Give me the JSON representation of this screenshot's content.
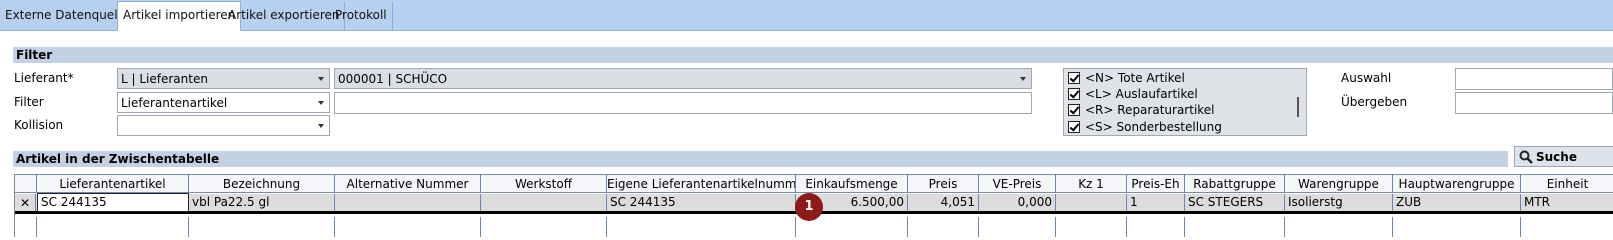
{
  "tabs": [
    {
      "label": "Externe Datenquelle"
    },
    {
      "label": "Artikel importieren"
    },
    {
      "label": "Artikel exportieren"
    },
    {
      "label": "Protokoll"
    }
  ],
  "filter": {
    "header": "Filter",
    "lieferant_label": "Lieferant*",
    "lieferant_type": "L | Lieferanten",
    "lieferant_value": "000001 | SCHÜCO",
    "filter_label": "Filter",
    "filter_value": "Lieferantenartikel",
    "filter_text": "",
    "kollision_label": "Kollision",
    "kollision_value": "",
    "checklist": [
      {
        "label": "<N> Tote Artikel",
        "checked": true
      },
      {
        "label": "<L> Auslaufartikel",
        "checked": true
      },
      {
        "label": "<R> Reparaturartikel",
        "checked": true
      },
      {
        "label": "<S> Sonderbestellung",
        "checked": true
      }
    ],
    "auswahl_label": "Auswahl",
    "uebergeben_label": "Übergeben"
  },
  "table": {
    "header": "Artikel in der Zwischentabelle",
    "search_label": "Suche",
    "columns": [
      "Lieferantenartikel",
      "Bezeichnung",
      "Alternative Nummer",
      "Werkstoff",
      "Eigene Lieferantenartikelnummer",
      "Einkaufsmenge",
      "Preis",
      "VE-Preis",
      "Kz 1",
      "Preis-Eh",
      "Rabattgruppe",
      "Warengruppe",
      "Hauptwarengruppe",
      "Einheit"
    ],
    "rows": [
      {
        "indicator": "✕",
        "cells": [
          "SC  244135",
          "vbl Pa22.5 gl",
          "",
          "",
          "SC  244135",
          "6.500,00",
          "4,051",
          "0,000",
          "",
          "1",
          "SC  STEGERS",
          "Isolierstg",
          "ZUB",
          "MTR"
        ]
      }
    ]
  },
  "marker": {
    "label": "1",
    "color": "#8b1a1a"
  }
}
